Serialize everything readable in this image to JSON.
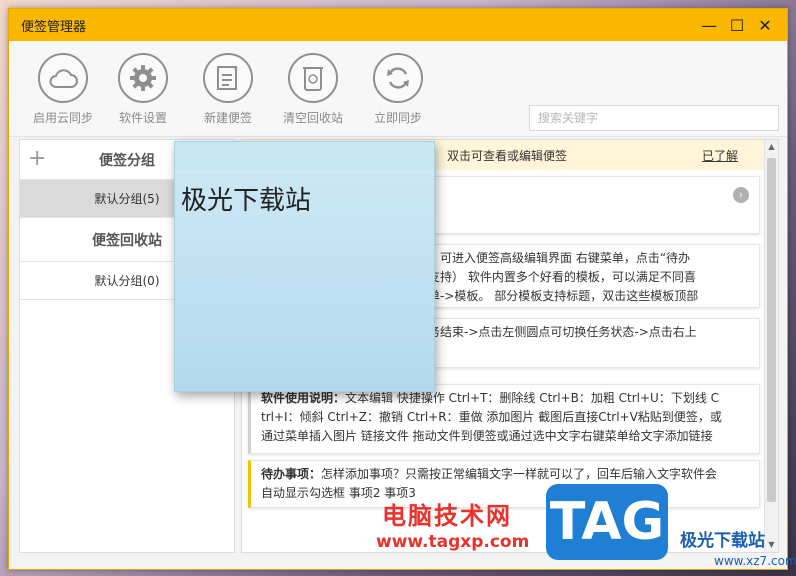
{
  "window": {
    "title": "便签管理器",
    "controls": {
      "min": "—",
      "max": "☐",
      "close": "✕"
    }
  },
  "toolbar": {
    "items": [
      {
        "label": "启用云同步",
        "icon": "cloud-icon"
      },
      {
        "label": "软件设置",
        "icon": "gear-icon"
      },
      {
        "label": "新建便签",
        "icon": "new-note-icon"
      },
      {
        "label": "清空回收站",
        "icon": "recycle-bin-icon"
      },
      {
        "label": "立即同步",
        "icon": "sync-icon"
      }
    ],
    "search_placeholder": "搜索关键字"
  },
  "sidebar": {
    "group_title": "便签分组",
    "group_item": "默认分组(5)",
    "recycle_title": "便签回收站",
    "recycle_item": "默认分组(0)"
  },
  "main": {
    "hint": "双击可查看或编辑便签",
    "hint_link": "已了解",
    "notes": [
      {
        "line1": "签，可进入便签高级编辑界面  右键菜单，点击“待办",
        "line2": "不支持）  软件内置多个好看的模板，可以满足不同喜",
        "line3": "菜单->模板。  部分模板支持标题，双击这些模板顶部"
      },
      {
        "line1": "任务结束->点击左侧圆点可切换任务状态->点击右上"
      },
      {
        "title": "软件使用说明：",
        "line1": "文本编辑  快捷操作 Ctrl+T：删除线 Ctrl+B：加粗 Ctrl+U：下划线 C",
        "line2": "trl+I：倾斜 Ctrl+Z：撤销 Ctrl+R：重做  添加图片 截图后直接Ctrl+V粘贴到便签，或",
        "line3": "通过菜单插入图片  链接文件 拖动文件到便签或通过选中文字右键菜单给文字添加链接"
      },
      {
        "title": "待办事项：",
        "line1": "怎样添加事项？只需按正常编辑文字一样就可以了，回车后输入文字软件会",
        "line2": "自动显示勾选框 事项2 事项3"
      }
    ]
  },
  "popup_note": {
    "text": "极光下载站"
  },
  "watermarks": {
    "site_cn": "电脑技术网",
    "site_url": "www.tagxp.com",
    "tag": "TAG",
    "right_cn": "极光下载站",
    "right_url": "www.xz7.com"
  },
  "colors": {
    "titlebar": "#fbb800",
    "hint_bg": "#fff6d9",
    "popup": "#c7e7f5"
  }
}
